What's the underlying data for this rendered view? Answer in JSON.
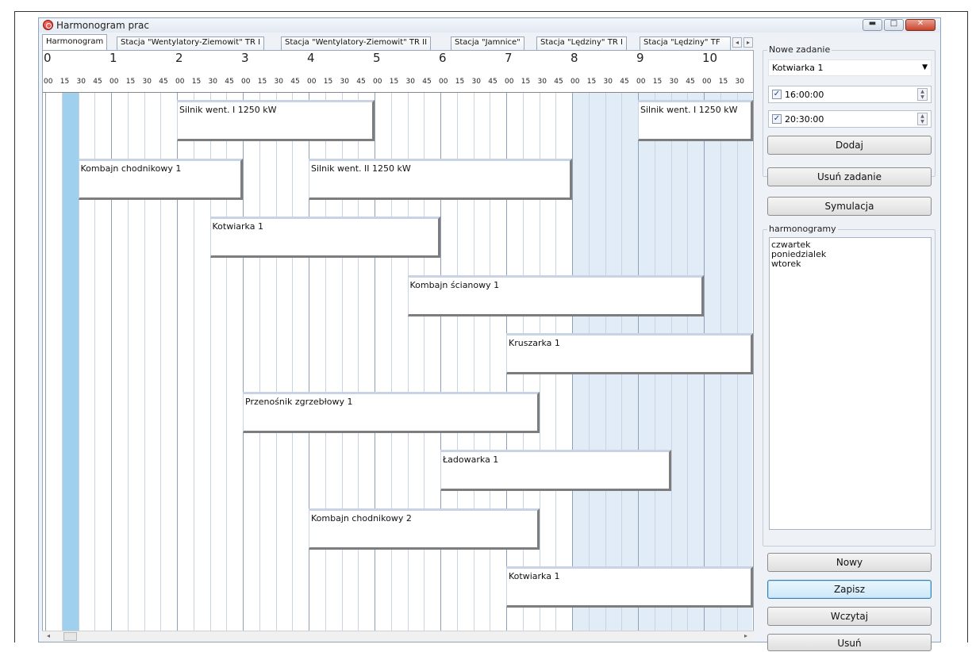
{
  "window": {
    "title": "Harmonogram prac",
    "buttons": {
      "minimize": "▬",
      "maximize": "□",
      "close": "✕"
    }
  },
  "tabs": [
    {
      "label": "Harmonogram",
      "active": true
    },
    {
      "label": "Stacja \"Wentylatory-Ziemowit\" TR I"
    },
    {
      "label": "Stacja \"Wentylatory-Ziemowit\" TR II"
    },
    {
      "label": "Stacja \"Jamnice\""
    },
    {
      "label": "Stacja \"Lędziny\" TR I"
    },
    {
      "label": "Stacja \"Lędziny\" TF"
    }
  ],
  "tab_scroll": {
    "left": "◂",
    "right": "▸"
  },
  "timeline": {
    "hours": [
      "0",
      "1",
      "2",
      "3",
      "4",
      "5",
      "6",
      "7",
      "8",
      "9",
      "10"
    ],
    "minutes": [
      "00",
      "15",
      "30",
      "45"
    ],
    "visible_until_hour": 10.75,
    "highlight_slot_start_hour": 0.25,
    "off_hours_start_hour": 8
  },
  "tasks": [
    {
      "label": "Silnik went. I 1250 kW",
      "start": 2.0,
      "end": 5.0
    },
    {
      "label": "Silnik went. I 1250 kW",
      "start": 9.0,
      "end": 10.75
    },
    {
      "label": "Kombajn chodnikowy 1",
      "start": 0.5,
      "end": 3.0
    },
    {
      "label": "Silnik went. II 1250 kW",
      "start": 4.0,
      "end": 8.0
    },
    {
      "label": "Kotwiarka 1",
      "start": 2.5,
      "end": 6.0
    },
    {
      "label": "Kombajn ścianowy 1",
      "start": 5.5,
      "end": 10.0
    },
    {
      "label": "Kruszarka 1",
      "start": 7.0,
      "end": 10.75
    },
    {
      "label": "Przenośnik zgrzebłowy 1",
      "start": 3.0,
      "end": 7.5
    },
    {
      "label": "Ładowarka 1",
      "start": 6.0,
      "end": 9.5
    },
    {
      "label": "Kombajn chodnikowy 2",
      "start": 4.0,
      "end": 7.5
    },
    {
      "label": "Kotwiarka 1",
      "start": 7.0,
      "end": 10.75
    }
  ],
  "right_panel": {
    "new_task_group": "Nowe zadanie",
    "task_select_value": "Kotwiarka 1",
    "start_time": "16:00:00",
    "end_time": "20:30:00",
    "add_button": "Dodaj",
    "remove_task_button": "Usuń zadanie",
    "simulation_button": "Symulacja",
    "schedules_group": "harmonogramy",
    "schedules": [
      "czwartek",
      "poniedzialek",
      "wtorek"
    ],
    "new_button": "Nowy",
    "save_button": "Zapisz",
    "load_button": "Wczytaj",
    "delete_button": "Usuń"
  },
  "icons": {
    "checkbox_checked": "✓",
    "dropdown_caret": "▼",
    "spin_up": "▲",
    "spin_down": "▼",
    "scroll_left": "◂",
    "scroll_right": "▸"
  }
}
